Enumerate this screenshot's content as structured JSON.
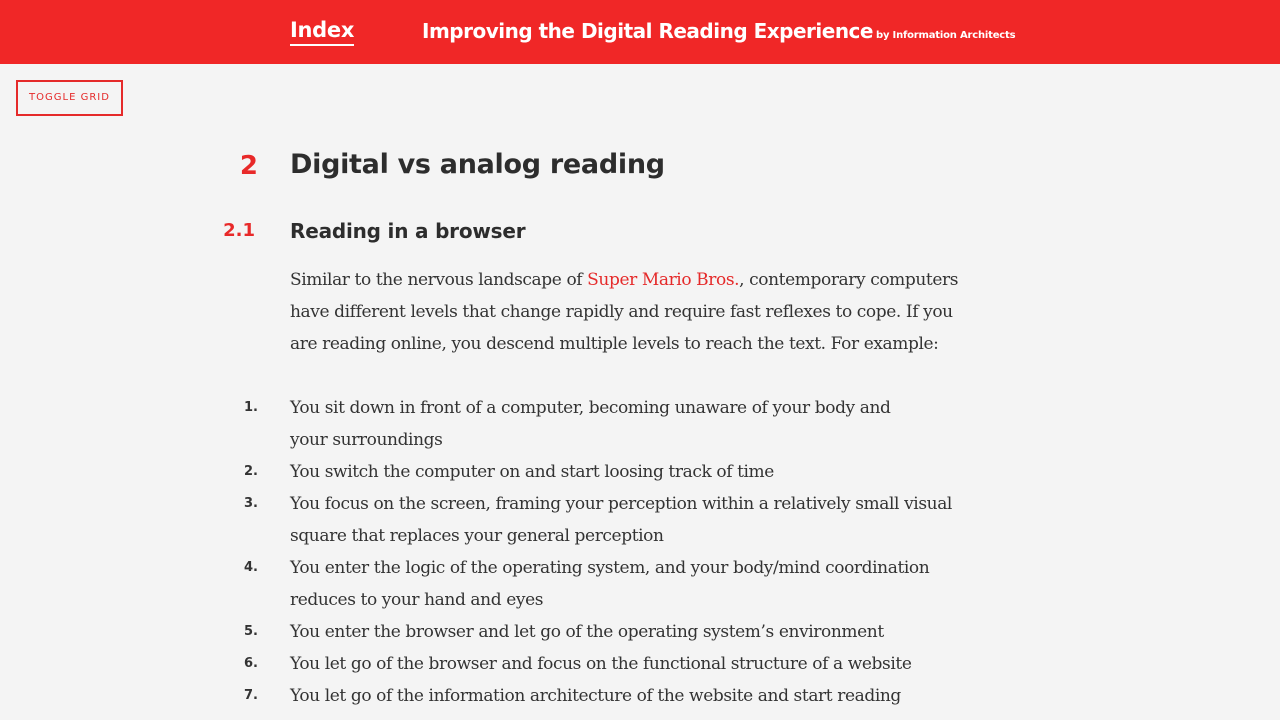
{
  "header": {
    "index_label": "Index",
    "title": "Improving the Digital Reading Experience",
    "byline": "by Information Architects"
  },
  "toggle_grid_label": "TOGGLE GRID",
  "section": {
    "number": "2",
    "title": "Digital vs analog reading"
  },
  "subsection": {
    "number": "2.1",
    "title": "Reading in a browser"
  },
  "paragraph": {
    "before_link": "Similar to the nervous landscape of ",
    "link_text": "Super Mario Bros.",
    "after_line_1": ", contemporary computers",
    "line_2": "have different levels that change rapidly and require fast reflexes to cope. If you",
    "line_3": "are reading online, you descend multiple levels to reach the text. For example:"
  },
  "steps": [
    {
      "n": "1.",
      "lines": [
        "You sit down in front of a computer, becoming unaware of your body and",
        "your surroundings"
      ]
    },
    {
      "n": "2.",
      "lines": [
        "You switch the computer on and start loosing track of time"
      ]
    },
    {
      "n": "3.",
      "lines": [
        "You focus on the screen, framing your perception within a relatively small visual",
        "square that replaces your general perception"
      ]
    },
    {
      "n": "4.",
      "lines": [
        "You enter the logic of the operating system, and your body/mind coordination",
        "reduces to your hand and eyes"
      ]
    },
    {
      "n": "5.",
      "lines": [
        "You enter the browser and let go of the operating system’s environment"
      ]
    },
    {
      "n": "6.",
      "lines": [
        "You let go of the browser and focus on the functional structure of a website"
      ]
    },
    {
      "n": "7.",
      "lines": [
        "You let go of the information architecture of the website and start reading"
      ]
    }
  ],
  "colors": {
    "accent": "#f02727",
    "text": "#333333",
    "background": "#f4f4f4"
  }
}
